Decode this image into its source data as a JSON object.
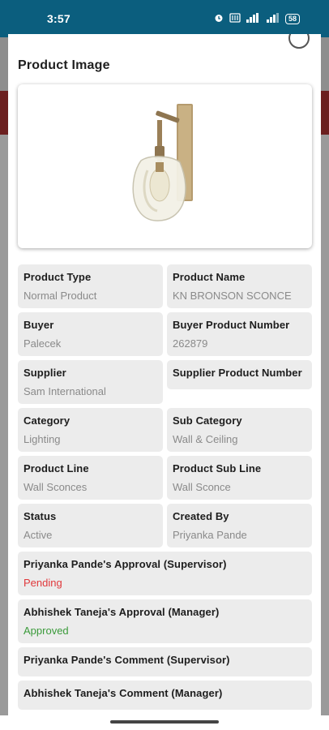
{
  "status_bar": {
    "time": "3:57",
    "battery": "58",
    "icons": [
      "alarm-icon",
      "data-icon",
      "signal-icon",
      "signal-icon",
      "battery-icon"
    ]
  },
  "sheet": {
    "title": "Product Image"
  },
  "fields": {
    "product_type": {
      "label": "Product Type",
      "value": "Normal Product"
    },
    "product_name": {
      "label": "Product Name",
      "value": "KN BRONSON SCONCE"
    },
    "buyer": {
      "label": "Buyer",
      "value": "Palecek"
    },
    "buyer_product_number": {
      "label": "Buyer Product Number",
      "value": "262879"
    },
    "supplier": {
      "label": "Supplier",
      "value": "Sam International"
    },
    "supplier_product_number": {
      "label": "Supplier Product Number",
      "value": ""
    },
    "category": {
      "label": "Category",
      "value": "Lighting"
    },
    "sub_category": {
      "label": "Sub Category",
      "value": "Wall & Ceiling"
    },
    "product_line": {
      "label": "Product Line",
      "value": "Wall Sconces"
    },
    "product_sub_line": {
      "label": "Product Sub Line",
      "value": "Wall Sconce"
    },
    "status": {
      "label": "Status",
      "value": "Active"
    },
    "created_by": {
      "label": "Created By",
      "value": "Priyanka Pande"
    },
    "supervisor_approval": {
      "label": "Priyanka Pande's Approval (Supervisor)",
      "value": "Pending"
    },
    "manager_approval": {
      "label": "Abhishek Taneja's Approval (Manager)",
      "value": "Approved"
    },
    "supervisor_comment": {
      "label": "Priyanka Pande's Comment (Supervisor)",
      "value": ""
    },
    "manager_comment": {
      "label": "Abhishek Taneja's Comment (Manager)",
      "value": ""
    }
  },
  "colors": {
    "status_bar": "#0b5e7e",
    "pending": "#e0383b",
    "approved": "#3a9a3a"
  }
}
